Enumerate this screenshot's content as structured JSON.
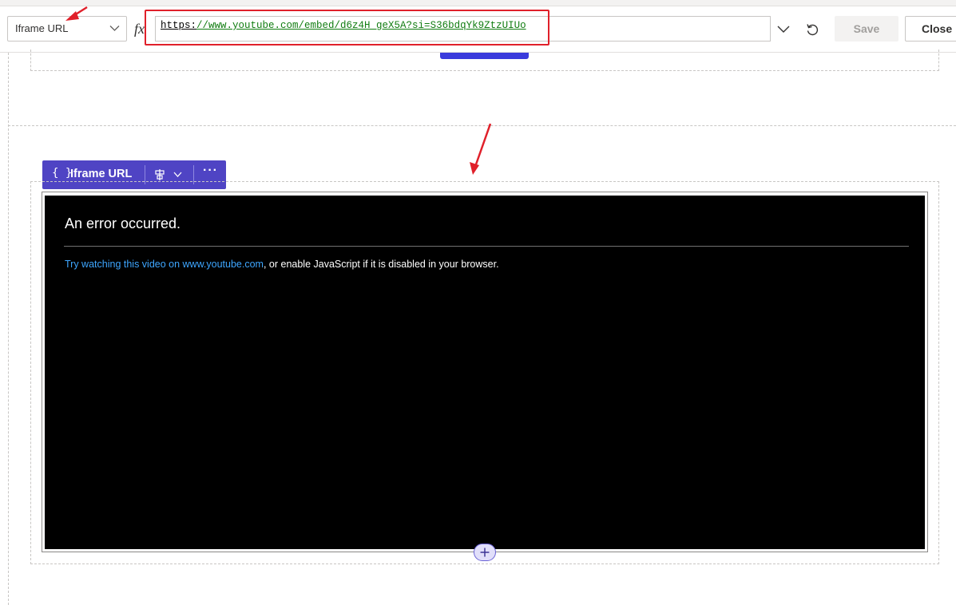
{
  "formula_bar": {
    "property_name": "Iframe URL",
    "fx_label": "fx",
    "formula_scheme": "https:",
    "formula_rest": "//www.youtube.com/embed/d6z4H_geX5A?si=S36bdqYk9ZtzUIUo",
    "save_label": "Save",
    "close_label": "Close"
  },
  "component_toolbar": {
    "label": "Iframe URL",
    "braces": "{ }",
    "more": "···"
  },
  "iframe": {
    "error_title": "An error occurred.",
    "link_text": "Try watching this video on www.youtube.com",
    "message_rest": ", or enable JavaScript if it is disabled in your browser."
  },
  "add_button_glyph": "+",
  "colors": {
    "toolbar_purple": "#4f44c4",
    "annotation_red": "#e0202a",
    "formula_green": "#107c10",
    "link_blue": "#3ea6ff"
  }
}
